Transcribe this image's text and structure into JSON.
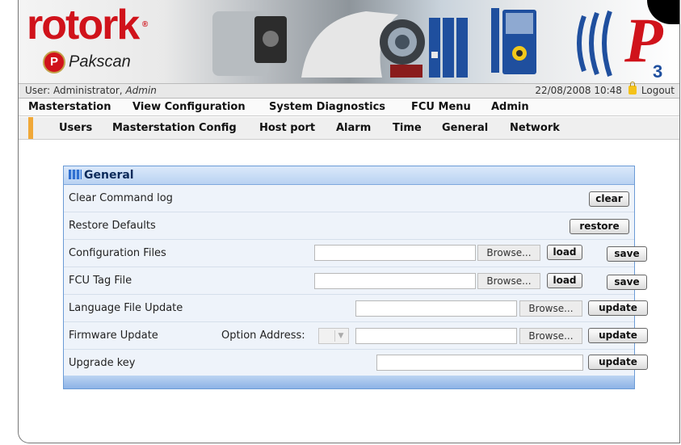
{
  "brand": {
    "logo_text": "rotork",
    "reg_mark": "®",
    "product_badge": "P",
    "product_name": "Pakscan",
    "p3_mark": "P3"
  },
  "userbar": {
    "user_prefix": "User: Administrator, ",
    "user_role": "Admin",
    "datetime": "22/08/2008 10:48",
    "logout_label": "Logout"
  },
  "main_menu": [
    "Masterstation",
    "View Configuration",
    "System Diagnostics",
    "FCU Menu",
    "Admin"
  ],
  "sub_menu": [
    "Users",
    "Masterstation Config",
    "Host port",
    "Alarm",
    "Time",
    "General",
    "Network"
  ],
  "panel": {
    "title": "General",
    "rows": {
      "clear_log": {
        "label": "Clear Command log",
        "button": "clear"
      },
      "restore": {
        "label": "Restore Defaults",
        "button": "restore"
      },
      "config_files": {
        "label": "Configuration Files",
        "file_value": "",
        "browse": "Browse...",
        "load": "load",
        "save": "save"
      },
      "fcu_tag": {
        "label": "FCU Tag File",
        "file_value": "",
        "browse": "Browse...",
        "load": "load",
        "save": "save"
      },
      "language": {
        "label": "Language File Update",
        "file_value": "",
        "browse": "Browse...",
        "button": "update"
      },
      "firmware": {
        "label": "Firmware Update",
        "option_label": "Option Address:",
        "option_value": "",
        "file_value": "",
        "browse": "Browse...",
        "button": "update"
      },
      "upgrade": {
        "label": "Upgrade key",
        "key_value": "",
        "button": "update"
      }
    }
  },
  "colors": {
    "brand_red": "#d0131b",
    "panel_border": "#6b9bd6",
    "row_bg": "#eef3fa",
    "submenu_accent": "#f0a838"
  }
}
